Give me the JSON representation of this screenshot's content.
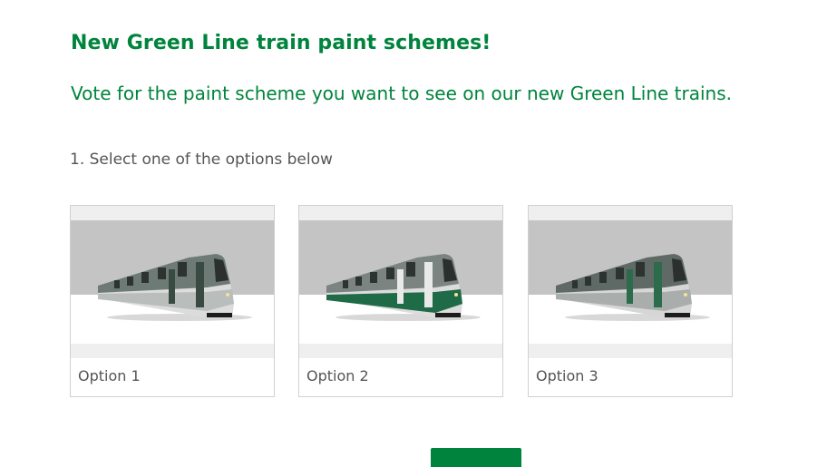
{
  "survey": {
    "title": "New Green Line train paint schemes!",
    "subtitle": "Vote for the paint scheme you want to see on our new Green Line trains."
  },
  "question": {
    "title": "1. Select one of the options below",
    "options": [
      {
        "label": "Option 1",
        "image_icon": "train-option-1-image"
      },
      {
        "label": "Option 2",
        "image_icon": "train-option-2-image"
      },
      {
        "label": "Option 3",
        "image_icon": "train-option-3-image"
      }
    ]
  },
  "colors": {
    "brand_green": "#00843d",
    "text_gray": "#555555",
    "card_border": "#d0d0d0",
    "image_band": "#c4c4c4",
    "image_background": "#efefef"
  }
}
